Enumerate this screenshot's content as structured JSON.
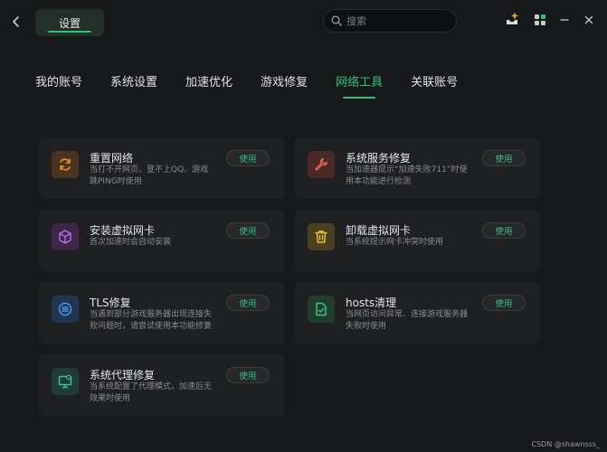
{
  "titlebar": {
    "settings_tab": "设置",
    "search_placeholder": "搜索"
  },
  "nav": {
    "tabs": [
      {
        "label": "我的账号",
        "active": false
      },
      {
        "label": "系统设置",
        "active": false
      },
      {
        "label": "加速优化",
        "active": false
      },
      {
        "label": "游戏修复",
        "active": false
      },
      {
        "label": "网络工具",
        "active": true
      },
      {
        "label": "关联账号",
        "active": false
      }
    ]
  },
  "cards": [
    {
      "title": "重置网络",
      "desc": "当打不开网页、登不上QQ、游戏跳PING时使用",
      "button": "使用",
      "icon": "refresh-icon",
      "color": "#d9822b",
      "bg": "#4a3320"
    },
    {
      "title": "系统服务修复",
      "desc": "当加速器提示“加速失败711”时使用本功能进行检测",
      "button": "使用",
      "icon": "wrench-icon",
      "color": "#e06a4f",
      "bg": "#4a2a24"
    },
    {
      "title": "安装虚拟网卡",
      "desc": "首次加速时会自动安装",
      "button": "使用",
      "icon": "cube-icon",
      "color": "#b36ee0",
      "bg": "#3c2748"
    },
    {
      "title": "卸载虚拟网卡",
      "desc": "当系统提示网卡冲突时使用",
      "button": "使用",
      "icon": "trash-icon",
      "color": "#e8c23a",
      "bg": "#4a4020"
    },
    {
      "title": "TLS修复",
      "desc": "当遇到部分游戏服务器出现连接失败问题时，请尝试使用本功能修复",
      "button": "使用",
      "icon": "shield-list-icon",
      "color": "#4a9ae8",
      "bg": "#1f3552"
    },
    {
      "title": "hosts清理",
      "desc": "当网页访问异常、连接游戏服务器失败时使用",
      "button": "使用",
      "icon": "document-check-icon",
      "color": "#3cc27e",
      "bg": "#203e2d"
    },
    {
      "title": "系统代理修复",
      "desc": "当系统配置了代理模式，加速后无效果时使用",
      "button": "使用",
      "icon": "monitor-icon",
      "color": "#3cc2a0",
      "bg": "#1f3d36"
    }
  ],
  "watermark": "CSDN @shawnsss_"
}
